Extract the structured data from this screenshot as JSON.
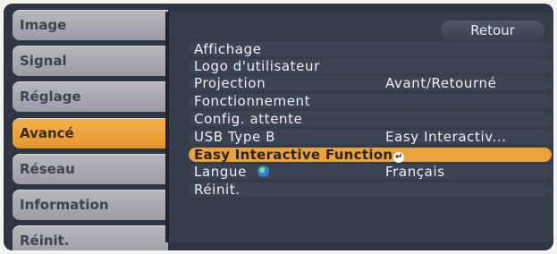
{
  "sidebar": {
    "items": [
      {
        "label": "Image",
        "active": false
      },
      {
        "label": "Signal",
        "active": false
      },
      {
        "label": "Réglage",
        "active": false
      },
      {
        "label": "Avancé",
        "active": true
      },
      {
        "label": "Réseau",
        "active": false
      },
      {
        "label": "Information",
        "active": false
      },
      {
        "label": "Réinit.",
        "active": false
      }
    ]
  },
  "panel": {
    "back_label": "Retour",
    "rows": [
      {
        "label": "Affichage",
        "value": ""
      },
      {
        "label": "Logo d'utilisateur",
        "value": ""
      },
      {
        "label": "Projection",
        "value": "Avant/Retourné"
      },
      {
        "label": "Fonctionnement",
        "value": ""
      },
      {
        "label": "Config. attente",
        "value": ""
      },
      {
        "label": "USB Type B",
        "value": "Easy Interactiv..."
      },
      {
        "label": "Easy Interactive Function",
        "value": "",
        "selected": true,
        "icon": "enter-icon"
      },
      {
        "label": "Langue",
        "value": "Français",
        "icon": "globe-icon"
      },
      {
        "label": "Réinit.",
        "value": ""
      }
    ]
  },
  "colors": {
    "background": "#2f3542",
    "accent": "#e9a33a",
    "tab": "#a9a9b0"
  }
}
